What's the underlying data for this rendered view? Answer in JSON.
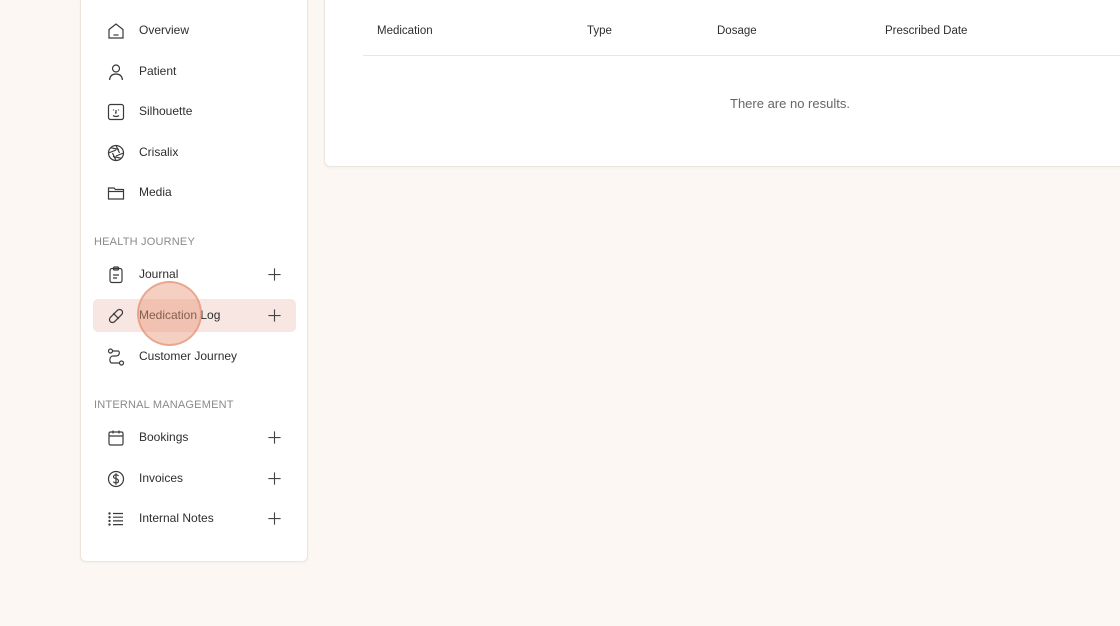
{
  "sidebar": {
    "main_items": [
      {
        "label": "Overview",
        "icon": "home-icon"
      },
      {
        "label": "Patient",
        "icon": "user-icon"
      },
      {
        "label": "Silhouette",
        "icon": "face-frame-icon"
      },
      {
        "label": "Crisalix",
        "icon": "aperture-icon"
      },
      {
        "label": "Media",
        "icon": "folder-icon"
      }
    ],
    "health_journey": {
      "heading": "HEALTH JOURNEY",
      "items": [
        {
          "label": "Journal",
          "icon": "clipboard-icon",
          "has_add": true
        },
        {
          "label": "Medication Log",
          "icon": "pill-icon",
          "has_add": true,
          "active": true
        },
        {
          "label": "Customer Journey",
          "icon": "route-icon",
          "has_add": false
        }
      ]
    },
    "internal_management": {
      "heading": "INTERNAL MANAGEMENT",
      "items": [
        {
          "label": "Bookings",
          "icon": "calendar-icon",
          "has_add": true
        },
        {
          "label": "Invoices",
          "icon": "dollar-circle-icon",
          "has_add": true
        },
        {
          "label": "Internal Notes",
          "icon": "list-icon",
          "has_add": true
        }
      ]
    }
  },
  "table": {
    "columns": [
      "Medication",
      "Type",
      "Dosage",
      "Prescribed Date"
    ],
    "empty_message": "There are no results."
  },
  "colors": {
    "background": "#fcf7f3",
    "active_item": "#f7e6e1",
    "cursor_highlight": "#e89678"
  }
}
